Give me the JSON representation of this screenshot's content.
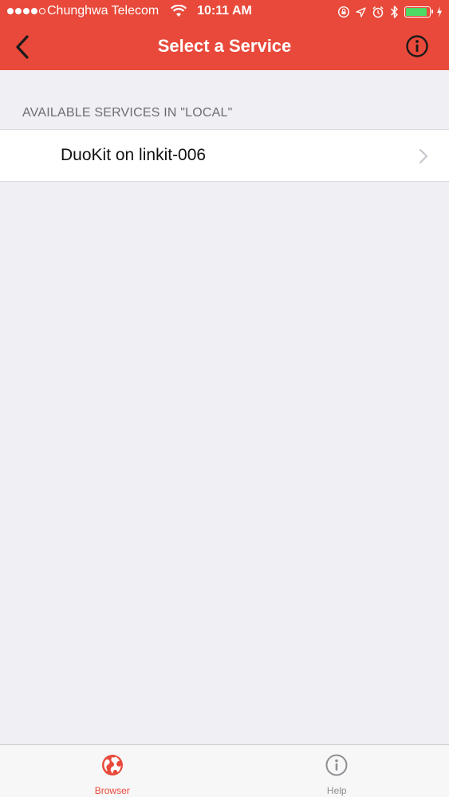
{
  "status_bar": {
    "carrier": "Chunghwa Telecom",
    "time": "10:11 AM",
    "signal_bars_filled": 4,
    "signal_bars_total": 5,
    "battery_level": 0.9,
    "icons": [
      "wifi-icon",
      "orientation-lock-icon",
      "location-icon",
      "alarm-icon",
      "bluetooth-icon",
      "battery-icon",
      "charging-icon"
    ]
  },
  "nav_bar": {
    "title": "Select a Service",
    "back_icon": "chevron-left-icon",
    "info_icon": "info-circle-icon"
  },
  "section": {
    "header": "AVAILABLE SERVICES IN \"LOCAL\""
  },
  "services": [
    {
      "name": "DuoKit on linkit-006"
    }
  ],
  "tab_bar": {
    "tabs": [
      {
        "label": "Browser",
        "icon": "globe-icon",
        "active": true
      },
      {
        "label": "Help",
        "icon": "info-circle-icon",
        "active": false
      }
    ]
  },
  "colors": {
    "accent": "#e8493a",
    "background": "#efeff4",
    "cell": "#ffffff",
    "section_text": "#6d6d72",
    "tab_inactive": "#8e8e93",
    "battery": "#4cd964"
  }
}
